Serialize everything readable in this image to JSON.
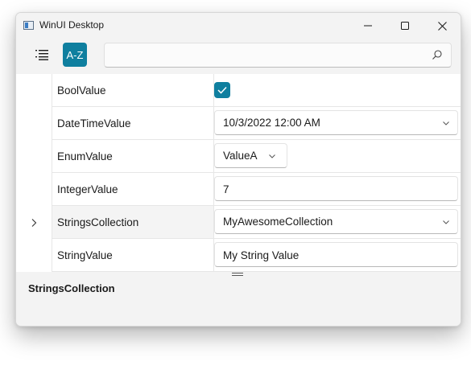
{
  "window": {
    "title": "WinUI Desktop",
    "controls": {
      "minimize": "minimize-icon",
      "maximize": "maximize-icon",
      "close": "close-icon"
    }
  },
  "toolbar": {
    "categorized_icon": "list-icon",
    "alphabetical_label": "A-Z",
    "alphabetical_active": true,
    "search": {
      "value": "",
      "placeholder": "",
      "icon": "search-icon"
    }
  },
  "properties": [
    {
      "name": "BoolValue",
      "editor": "checkbox",
      "checked": true
    },
    {
      "name": "DateTimeValue",
      "editor": "combobox",
      "value": "10/3/2022 12:00 AM"
    },
    {
      "name": "EnumValue",
      "editor": "combobox",
      "value": "ValueA"
    },
    {
      "name": "IntegerValue",
      "editor": "textbox",
      "value": "7"
    },
    {
      "name": "StringsCollection",
      "editor": "combobox",
      "value": "MyAwesomeCollection",
      "expandable": true,
      "selected": true
    },
    {
      "name": "StringValue",
      "editor": "textbox",
      "value": "My String Value"
    }
  ],
  "description": {
    "title": "StringsCollection"
  },
  "colors": {
    "accent": "#0f7f9f",
    "window_bg": "#f3f3f3",
    "grid_bg": "#ffffff"
  }
}
